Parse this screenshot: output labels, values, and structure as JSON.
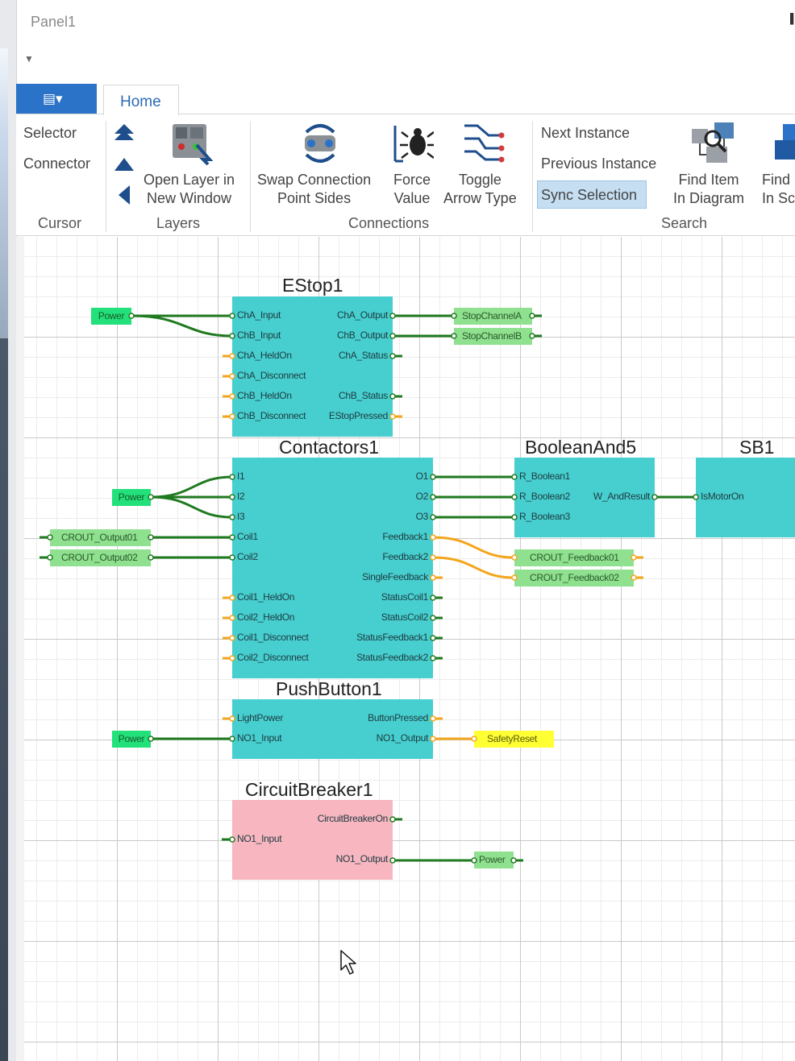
{
  "window": {
    "title": "Panel1"
  },
  "tabs": {
    "file_icon": "list-menu-icon",
    "home": "Home"
  },
  "ribbon": {
    "cursor_group": {
      "label": "Cursor",
      "selector": "Selector",
      "connector": "Connector"
    },
    "layers_group": {
      "label": "Layers",
      "open_layer_line1": "Open Layer in",
      "open_layer_line2": "New Window"
    },
    "connections_group": {
      "label": "Connections",
      "swap_line1": "Swap Connection",
      "swap_line2": "Point Sides",
      "force_line1": "Force",
      "force_line2": "Value",
      "toggle_line1": "Toggle",
      "toggle_line2": "Arrow Type"
    },
    "search_group": {
      "label": "Search",
      "next_instance": "Next Instance",
      "previous_instance": "Previous Instance",
      "sync_selection": "Sync Selection",
      "find_item_line1": "Find Item",
      "find_item_line2": "In Diagram",
      "find_sc_line1": "Find",
      "find_sc_line2": "In Sc"
    }
  },
  "colors": {
    "block": "#47cfcf",
    "tag_green": "#8fe08f",
    "tag_power": "#22e07a",
    "tag_yellow": "#ffff33",
    "block_pink": "#f7b6c0",
    "wire_green": "#1f7a1f",
    "wire_orange": "#f3a51c",
    "accent": "#2b73c8"
  },
  "diagram": {
    "estop": {
      "title": "EStop1",
      "inputs": [
        "ChA_Input",
        "ChB_Input",
        "ChA_HeldOn",
        "ChA_Disconnect",
        "ChB_HeldOn",
        "ChB_Disconnect"
      ],
      "outputs": [
        "ChA_Output",
        "ChB_Output",
        "ChA_Status",
        "",
        "ChB_Status",
        "EStopPressed"
      ]
    },
    "contactors": {
      "title": "Contactors1",
      "inputs": [
        "I1",
        "I2",
        "I3",
        "Coil1",
        "Coil2",
        "",
        "Coil1_HeldOn",
        "Coil2_HeldOn",
        "Coil1_Disconnect",
        "Coil2_Disconnect"
      ],
      "outputs": [
        "O1",
        "O2",
        "O3",
        "Feedback1",
        "Feedback2",
        "SingleFeedback",
        "StatusCoil1",
        "StatusCoil2",
        "StatusFeedback1",
        "StatusFeedback2"
      ]
    },
    "booleanand": {
      "title": "BooleanAnd5",
      "inputs": [
        "R_Boolean1",
        "R_Boolean2",
        "R_Boolean3"
      ],
      "output": "W_AndResult"
    },
    "sb": {
      "title": "SB1",
      "inputs": [
        "IsMotorOn"
      ]
    },
    "pushbutton": {
      "title": "PushButton1",
      "inputs": [
        "LightPower",
        "NO1_Input"
      ],
      "outputs": [
        "ButtonPressed",
        "NO1_Output"
      ]
    },
    "circuitbreaker": {
      "title": "CircuitBreaker1",
      "input": "NO1_Input",
      "outputs": [
        "CircuitBreakerOn",
        "NO1_Output"
      ]
    },
    "tags": {
      "power": "Power",
      "stop_a": "StopChannelA",
      "stop_b": "StopChannelB",
      "crout_out1": "CROUT_Output01",
      "crout_out2": "CROUT_Output02",
      "crout_fb1": "CROUT_Feedback01",
      "crout_fb2": "CROUT_Feedback02",
      "safety_reset": "SafetyReset"
    }
  }
}
